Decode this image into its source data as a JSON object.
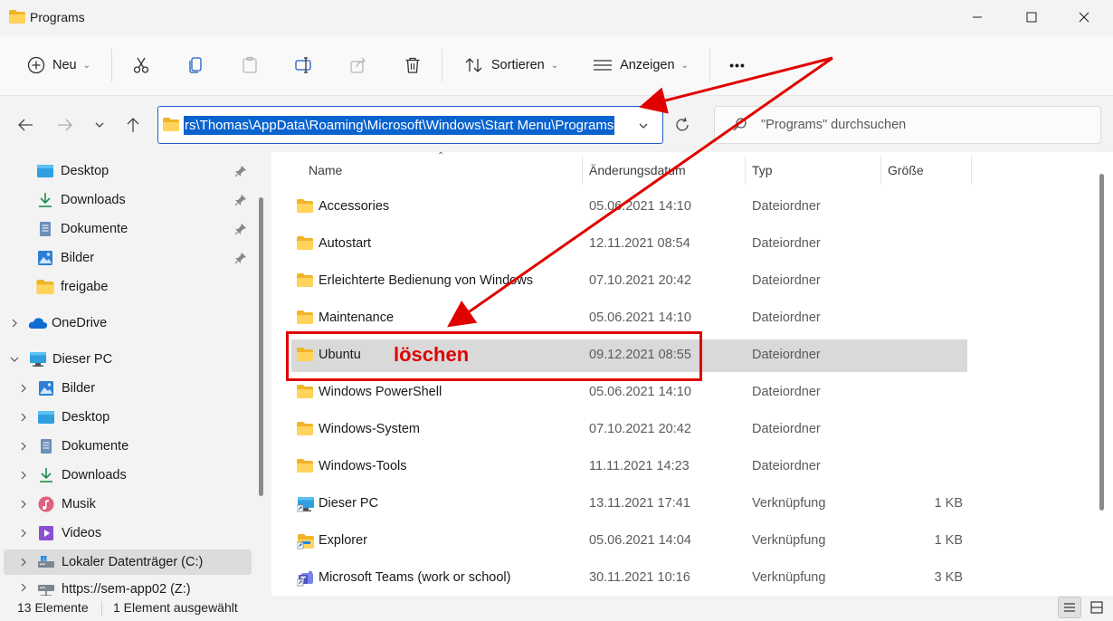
{
  "window": {
    "title": "Programs",
    "controls": [
      "minimize",
      "maximize",
      "close"
    ]
  },
  "toolbar": {
    "new_label": "Neu",
    "sort_label": "Sortieren",
    "view_label": "Anzeigen",
    "more_label": "•••"
  },
  "address": {
    "path": "rs\\Thomas\\AppData\\Roaming\\Microsoft\\Windows\\Start Menu\\Programs"
  },
  "search": {
    "placeholder": "\"Programs\" durchsuchen"
  },
  "sidebar": {
    "quick": [
      {
        "label": "Desktop",
        "icon": "desktop-icon",
        "pinned": true
      },
      {
        "label": "Downloads",
        "icon": "download-icon",
        "pinned": true
      },
      {
        "label": "Dokumente",
        "icon": "document-icon",
        "pinned": true
      },
      {
        "label": "Bilder",
        "icon": "pictures-icon",
        "pinned": true
      },
      {
        "label": "freigabe",
        "icon": "folder-icon",
        "pinned": false
      }
    ],
    "onedrive": "OneDrive",
    "this_pc": "Dieser PC",
    "pc_items": [
      {
        "label": "Bilder",
        "icon": "pictures-icon"
      },
      {
        "label": "Desktop",
        "icon": "desktop-icon"
      },
      {
        "label": "Dokumente",
        "icon": "document-icon"
      },
      {
        "label": "Downloads",
        "icon": "download-icon"
      },
      {
        "label": "Musik",
        "icon": "music-icon"
      },
      {
        "label": "Videos",
        "icon": "video-icon"
      },
      {
        "label": "Lokaler Datenträger (C:)",
        "icon": "drive-icon"
      },
      {
        "label": "https://sem-app02 (Z:)",
        "icon": "network-drive-icon"
      }
    ]
  },
  "columns": {
    "name": "Name",
    "date": "Änderungsdatum",
    "type": "Typ",
    "size": "Größe"
  },
  "files": [
    {
      "name": "Accessories",
      "date": "05.06.2021 14:10",
      "type": "Dateiordner",
      "size": "",
      "icon": "folder-icon"
    },
    {
      "name": "Autostart",
      "date": "12.11.2021 08:54",
      "type": "Dateiordner",
      "size": "",
      "icon": "folder-icon"
    },
    {
      "name": "Erleichterte Bedienung von Windows",
      "date": "07.10.2021 20:42",
      "type": "Dateiordner",
      "size": "",
      "icon": "folder-icon"
    },
    {
      "name": "Maintenance",
      "date": "05.06.2021 14:10",
      "type": "Dateiordner",
      "size": "",
      "icon": "folder-icon"
    },
    {
      "name": "Ubuntu",
      "date": "09.12.2021 08:55",
      "type": "Dateiordner",
      "size": "",
      "icon": "folder-icon",
      "selected": true
    },
    {
      "name": "Windows PowerShell",
      "date": "05.06.2021 14:10",
      "type": "Dateiordner",
      "size": "",
      "icon": "folder-icon"
    },
    {
      "name": "Windows-System",
      "date": "07.10.2021 20:42",
      "type": "Dateiordner",
      "size": "",
      "icon": "folder-icon"
    },
    {
      "name": "Windows-Tools",
      "date": "11.11.2021 14:23",
      "type": "Dateiordner",
      "size": "",
      "icon": "folder-icon"
    },
    {
      "name": "Dieser PC",
      "date": "13.11.2021 17:41",
      "type": "Verknüpfung",
      "size": "1 KB",
      "icon": "pc-shortcut-icon"
    },
    {
      "name": "Explorer",
      "date": "05.06.2021 14:04",
      "type": "Verknüpfung",
      "size": "1 KB",
      "icon": "explorer-shortcut-icon"
    },
    {
      "name": "Microsoft Teams (work or school)",
      "date": "30.11.2021 10:16",
      "type": "Verknüpfung",
      "size": "3 KB",
      "icon": "teams-shortcut-icon"
    }
  ],
  "status": {
    "count": "13 Elemente",
    "selection": "1 Element ausgewählt"
  },
  "annotation": {
    "label": "löschen",
    "color": "#e00000"
  },
  "colors": {
    "accent": "#0b63ce",
    "folder": "#f5c04a",
    "selected_row": "#d9d9d9"
  }
}
